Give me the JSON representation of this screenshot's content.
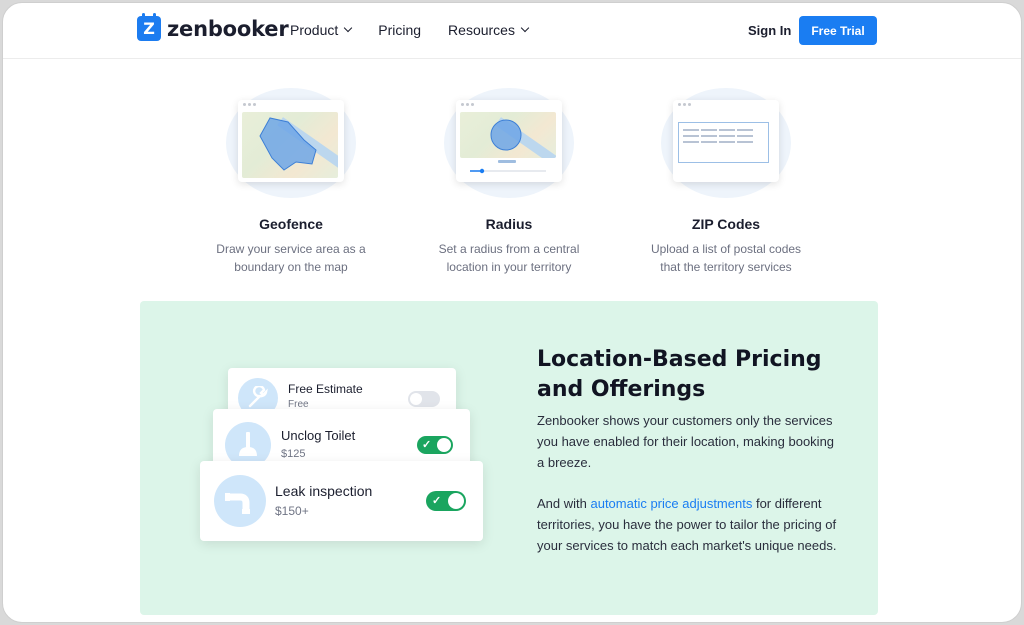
{
  "nav": {
    "logo_mark": "Z",
    "logo_text": "zenbooker",
    "items": [
      {
        "label": "Product",
        "has_dropdown": true
      },
      {
        "label": "Pricing",
        "has_dropdown": false
      },
      {
        "label": "Resources",
        "has_dropdown": true
      }
    ],
    "sign_in": "Sign In",
    "free_trial": "Free Trial"
  },
  "features": [
    {
      "title": "Geofence",
      "desc_line1": "Draw your service area as a",
      "desc_line2": "boundary on the map"
    },
    {
      "title": "Radius",
      "desc_line1": "Set a radius from a central",
      "desc_line2": "location in your territory"
    },
    {
      "title": "ZIP Codes",
      "desc_line1": "Upload a list of postal codes",
      "desc_line2": "that the territory services"
    }
  ],
  "services": [
    {
      "name": "Free Estimate",
      "price": "Free",
      "enabled": false,
      "icon": "wrench-icon"
    },
    {
      "name": "Unclog Toilet",
      "price": "$125",
      "enabled": true,
      "icon": "plunger-icon"
    },
    {
      "name": "Leak inspection",
      "price": "$150+",
      "enabled": true,
      "icon": "pipe-icon"
    }
  ],
  "section": {
    "heading_line1": "Location-Based Pricing",
    "heading_line2": "and Offerings",
    "para1": "Zenbooker shows your customers only the services you have enabled for their location, making booking a breeze.",
    "para2_before": "And with ",
    "para2_link": "automatic price adjustments",
    "para2_after": " for different territories, you have the power to tailor the pricing of your services to match each market's unique needs."
  },
  "colors": {
    "accent": "#1a7df2",
    "section_bg": "#dcf5e9",
    "toggle_on": "#1aa55f"
  }
}
